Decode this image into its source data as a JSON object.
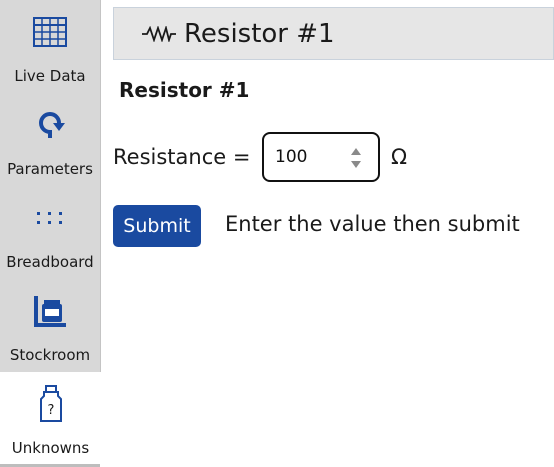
{
  "sidebar": {
    "items": [
      {
        "label": "Live Data",
        "icon": "grid-table-icon"
      },
      {
        "label": "Parameters",
        "icon": "rotate-arrow-icon"
      },
      {
        "label": "Breadboard",
        "icon": "dots-grid-icon"
      },
      {
        "label": "Stockroom",
        "icon": "jar-shelf-icon"
      },
      {
        "label": "Unknowns",
        "icon": "question-bottle-icon"
      }
    ],
    "active": "Unknowns",
    "accent_color": "#1a4aa0"
  },
  "header": {
    "title": "Resistor #1",
    "icon": "resistor-icon"
  },
  "form": {
    "section_title": "Resistor #1",
    "resistance_label": "Resistance =",
    "resistance_value": "100",
    "unit": "Ω",
    "submit_label": "Submit",
    "hint": "Enter the value then submit"
  }
}
